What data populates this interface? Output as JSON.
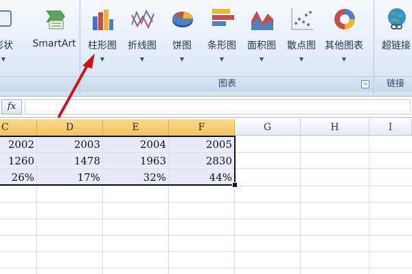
{
  "ribbon": {
    "partial_left_label": "形状",
    "partial_left_visible": "彩状",
    "smartart_label": "SmartArt",
    "group_left_label": "",
    "charts_group_label": "图表",
    "links_group_label": "链接",
    "buttons": [
      {
        "label": "柱形图",
        "icon": "column-chart-icon"
      },
      {
        "label": "折线图",
        "icon": "line-chart-icon"
      },
      {
        "label": "饼图",
        "icon": "pie-chart-icon"
      },
      {
        "label": "条形图",
        "icon": "bar-chart-icon"
      },
      {
        "label": "面积图",
        "icon": "area-chart-icon"
      },
      {
        "label": "散点图",
        "icon": "scatter-chart-icon"
      },
      {
        "label": "其他图表",
        "icon": "other-charts-icon"
      }
    ],
    "hyperlink_label": "超链接"
  },
  "formula_bar": {
    "fx_label": "fx",
    "value": ""
  },
  "sheet": {
    "columns": [
      "C",
      "D",
      "E",
      "F",
      "G",
      "H",
      "I"
    ],
    "selected_columns": [
      "C",
      "D",
      "E",
      "F"
    ],
    "rows": [
      [
        "2002",
        "2003",
        "2004",
        "2005"
      ],
      [
        "1260",
        "1478",
        "1963",
        "2830"
      ],
      [
        "26%",
        "17%",
        "32%",
        "44%"
      ]
    ]
  },
  "colors": {
    "annotation_arrow": "#c8141a",
    "selected_header": "#f6c25d",
    "selection_fill": "#e6ebf6"
  }
}
